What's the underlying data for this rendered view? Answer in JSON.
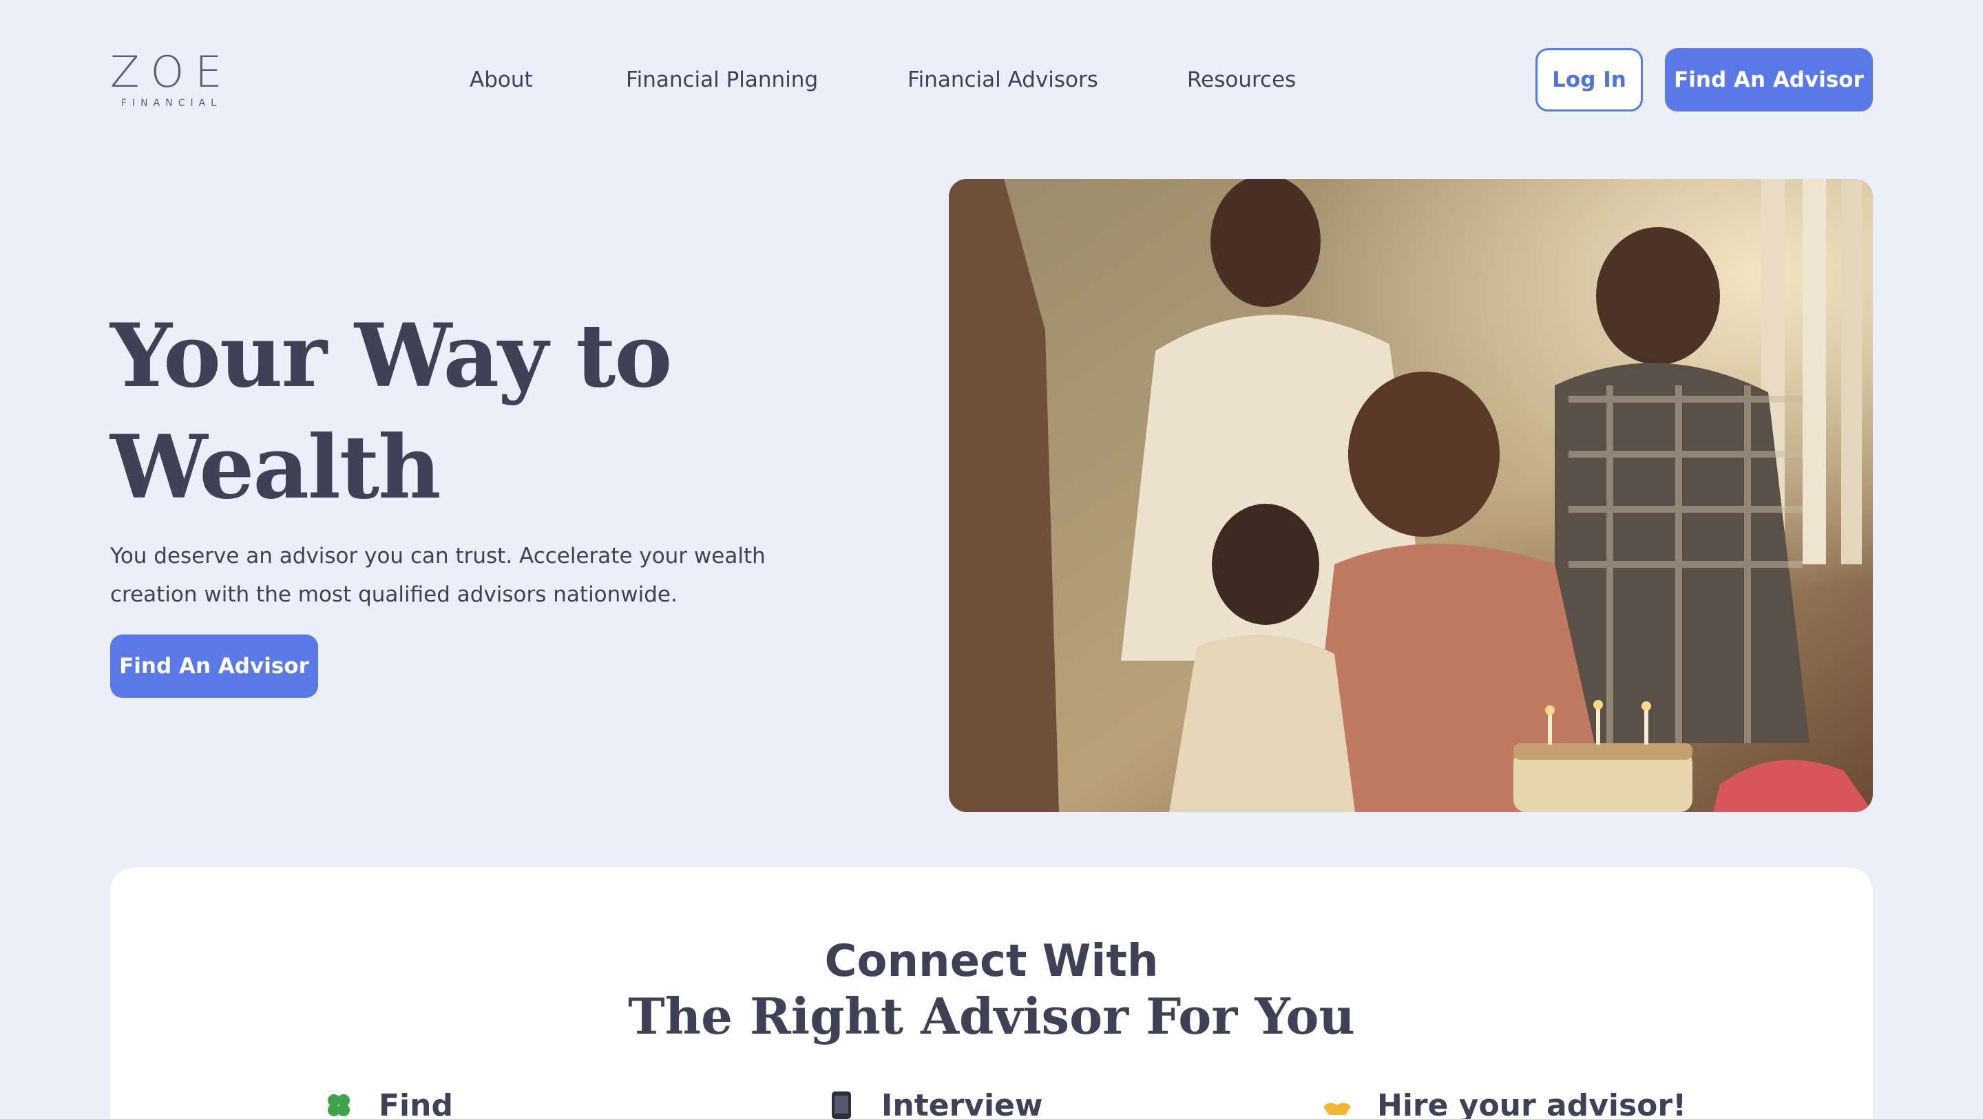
{
  "header": {
    "logo": {
      "word": "ZOE",
      "sub": "FINANCIAL"
    },
    "nav": [
      {
        "label": "About"
      },
      {
        "label": "Financial Planning"
      },
      {
        "label": "Financial Advisors"
      },
      {
        "label": "Resources"
      }
    ],
    "login_label": "Log In",
    "cta_label": "Find An Advisor"
  },
  "hero": {
    "title_line1": "Your Way to",
    "title_line2": "Wealth",
    "subtitle_line1": "You deserve an advisor you can trust. Accelerate your wealth",
    "subtitle_line2": "creation with the most qualified advisors nationwide.",
    "cta_label": "Find An Advisor",
    "image_alt": "family-celebrating-birthday-photo"
  },
  "connect": {
    "heading_line1": "Connect With",
    "heading_line2": "The Right Advisor For You",
    "steps": [
      {
        "label": "Find",
        "icon": "clover-icon"
      },
      {
        "label": "Interview",
        "icon": "phone-icon"
      },
      {
        "label": "Hire your advisor!",
        "icon": "handshake-icon"
      }
    ]
  },
  "colors": {
    "background": "#eceefa",
    "accent": "#5b79e6",
    "text": "#3f4256",
    "card": "#ffffff"
  }
}
